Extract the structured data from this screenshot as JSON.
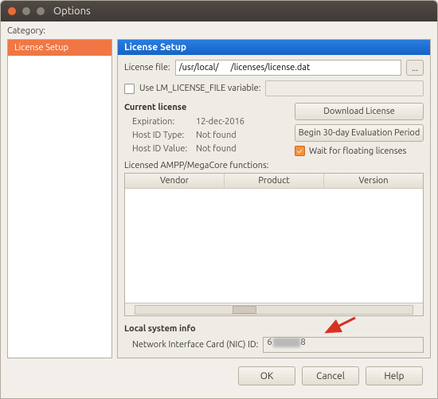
{
  "window": {
    "title": "Options"
  },
  "category_label": "Category:",
  "sidebar": {
    "items": [
      {
        "label": "License Setup"
      }
    ]
  },
  "panel": {
    "title": "License Setup",
    "license_file_label": "License file:",
    "license_file_value": "/usr/local/      /licenses/license.dat",
    "browse_label": "...",
    "use_lm_var_label": "Use LM_LICENSE_FILE variable:",
    "use_lm_var_checked": false,
    "current_license_heading": "Current license",
    "rows": {
      "expiration_label": "Expiration:",
      "expiration_value": "12-dec-2016",
      "hostid_type_label": "Host ID Type:",
      "hostid_type_value": "Not found",
      "hostid_value_label": "Host ID Value:",
      "hostid_value_value": "Not found"
    },
    "buttons": {
      "download": "Download License",
      "evaluation": "Begin 30-day Evaluation Period"
    },
    "wait_label": "Wait for floating licenses",
    "wait_checked": true,
    "functions_label": "Licensed AMPP/MegaCore functions:",
    "columns": {
      "vendor": "Vendor",
      "product": "Product",
      "version": "Version"
    },
    "local_sysinfo_heading": "Local system info",
    "nic_label": "Network Interface Card (NIC) ID:",
    "nic_value_prefix": "6",
    "nic_value_suffix": "8"
  },
  "footer": {
    "ok": "OK",
    "cancel": "Cancel",
    "help": "Help"
  }
}
